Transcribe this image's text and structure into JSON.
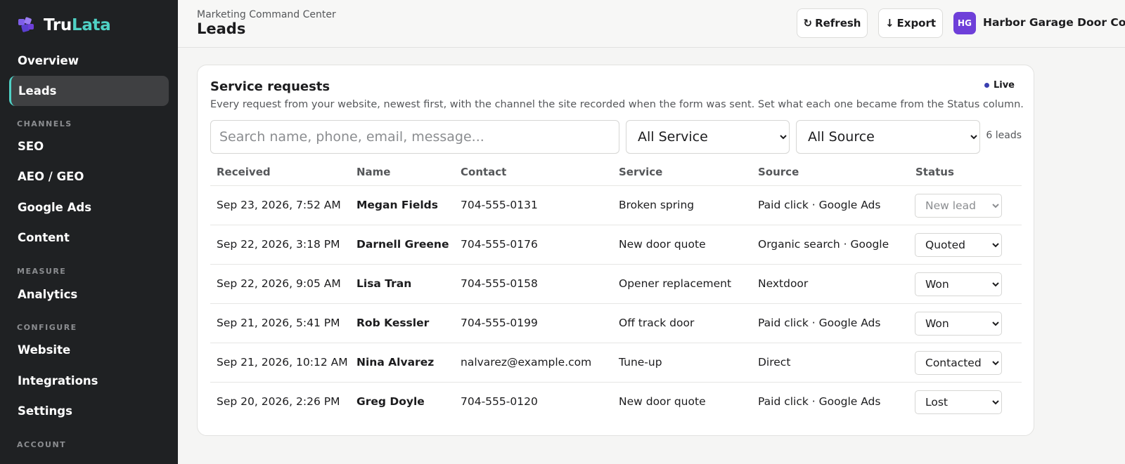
{
  "brand": {
    "part1": "Tru",
    "part2": "Lata"
  },
  "sidebar": {
    "items": [
      {
        "label": "Overview"
      },
      {
        "label": "Leads"
      },
      {
        "label": "SEO"
      },
      {
        "label": "AEO / GEO"
      },
      {
        "label": "Google Ads"
      },
      {
        "label": "Content"
      },
      {
        "label": "Analytics"
      },
      {
        "label": "Website"
      },
      {
        "label": "Integrations"
      },
      {
        "label": "Settings"
      }
    ],
    "sections": [
      "CHANNELS",
      "MEASURE",
      "CONFIGURE",
      "ACCOUNT"
    ],
    "active_item": "Leads"
  },
  "header": {
    "breadcrumb": "Marketing Command Center",
    "title": "Leads",
    "refresh_label": "Refresh",
    "refresh_icon": "↻",
    "export_label": "Export",
    "export_icon": "↓",
    "avatar_initials": "HG",
    "company": "Harbor Garage Door Co."
  },
  "card": {
    "title": "Service requests",
    "description": "Every request from your website, newest first, with the channel the site recorded when the form was sent. Set what each one became from the Status column.",
    "live_label": "Live",
    "search_placeholder": "Search name, phone, email, message...",
    "service_filter": "All Service",
    "source_filter": "All Source",
    "count": "6 leads"
  },
  "table": {
    "columns": [
      "Received",
      "Name",
      "Contact",
      "Service",
      "Source",
      "Status"
    ],
    "rows": [
      {
        "received": "Sep 23, 2026, 7:52 AM",
        "name": "Megan Fields",
        "contact": "704-555-0131",
        "service": "Broken spring",
        "source": "Paid click · Google Ads",
        "status": "New lead"
      },
      {
        "received": "Sep 22, 2026, 3:18 PM",
        "name": "Darnell Greene",
        "contact": "704-555-0176",
        "service": "New door quote",
        "source": "Organic search · Google",
        "status": "Quoted"
      },
      {
        "received": "Sep 22, 2026, 9:05 AM",
        "name": "Lisa Tran",
        "contact": "704-555-0158",
        "service": "Opener replacement",
        "source": "Nextdoor",
        "status": "Won"
      },
      {
        "received": "Sep 21, 2026, 5:41 PM",
        "name": "Rob Kessler",
        "contact": "704-555-0199",
        "service": "Off track door",
        "source": "Paid click · Google Ads",
        "status": "Won"
      },
      {
        "received": "Sep 21, 2026, 10:12 AM",
        "name": "Nina Alvarez",
        "contact": "nalvarez@example.com",
        "service": "Tune-up",
        "source": "Direct",
        "status": "Contacted"
      },
      {
        "received": "Sep 20, 2026, 2:26 PM",
        "name": "Greg Doyle",
        "contact": "704-555-0120",
        "service": "New door quote",
        "source": "Paid click · Google Ads",
        "status": "Lost"
      }
    ]
  },
  "colors": {
    "sidebar_bg": "#1f2123",
    "accent": "#4fd1c5",
    "avatar": "#6e3fd9",
    "live_dot": "#3a3fb0"
  }
}
